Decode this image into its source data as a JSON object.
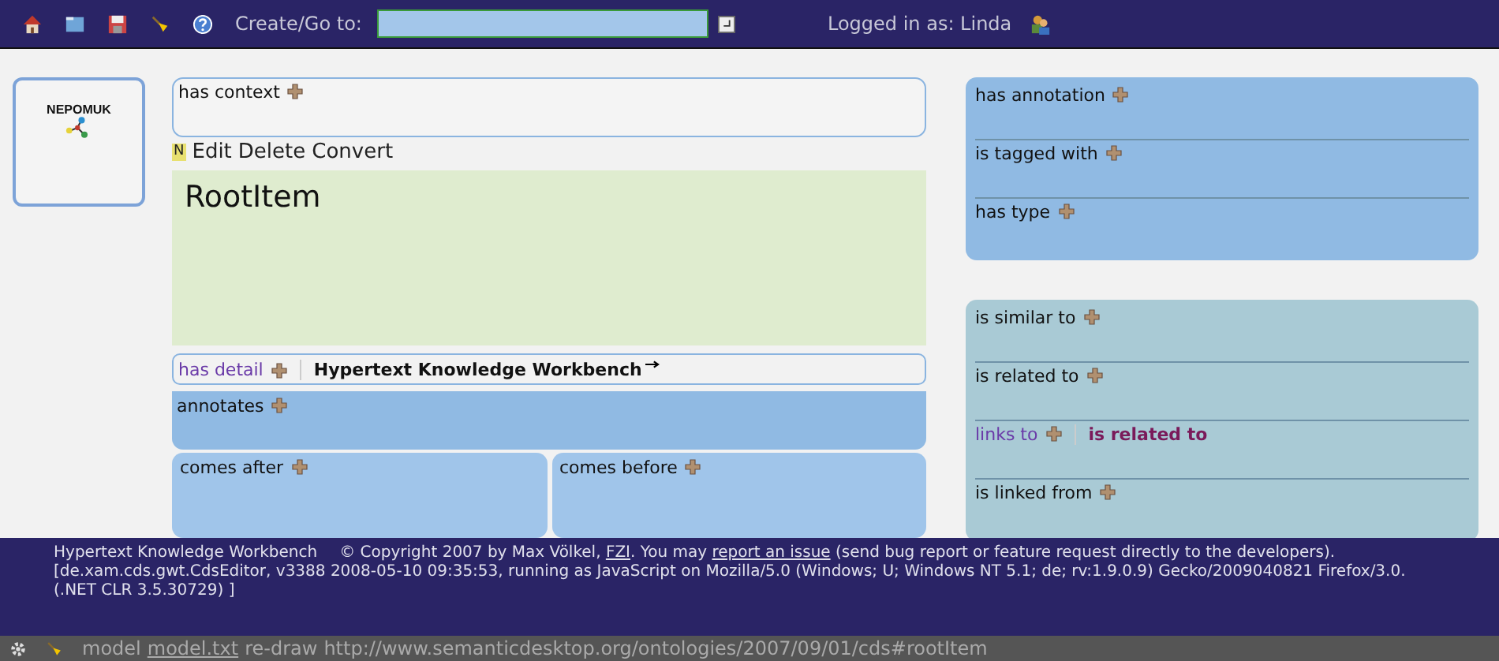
{
  "toolbar": {
    "create_label": "Create/Go to:",
    "login": "Logged in as: Linda"
  },
  "logo": {
    "text": "NEPOMUK"
  },
  "context": {
    "label": "has context"
  },
  "item": {
    "badge": "N",
    "actions": [
      "Edit",
      "Delete",
      "Convert"
    ],
    "title": "RootItem"
  },
  "detail": {
    "label": "has detail",
    "value": "Hypertext Knowledge Workbench"
  },
  "annotates": {
    "label": "annotates"
  },
  "sequence": [
    {
      "label": "comes after"
    },
    {
      "label": "comes before"
    }
  ],
  "right_panels": [
    {
      "color": "#90bae3",
      "rows": [
        {
          "label": "has annotation",
          "kind": "plain"
        },
        {
          "label": "is tagged with",
          "kind": "plain"
        },
        {
          "label": "has type",
          "kind": "plain"
        }
      ]
    },
    {
      "color": "#a9cad5",
      "rows": [
        {
          "label": "is similar to",
          "kind": "plain"
        },
        {
          "label": "is related to",
          "kind": "plain"
        },
        {
          "label": "links to",
          "kind": "linked",
          "value": "is related to"
        },
        {
          "label": "is linked from",
          "kind": "plain"
        }
      ]
    }
  ],
  "footer": {
    "app": "Hypertext Knowledge Workbench",
    "notice": [
      {
        "kind": "text",
        "text": "© Copyright 2007 by Max Völkel, "
      },
      {
        "kind": "link",
        "text": "FZI"
      },
      {
        "kind": "text",
        "text": ".  You may "
      },
      {
        "kind": "link",
        "text": "report an issue"
      },
      {
        "kind": "text",
        "text": " (send bug report or feature request directly to the developers)."
      }
    ],
    "build_lines": [
      "[de.xam.cds.gwt.CdsEditor, v3388 2008-05-10 09:35:53, running as JavaScript on Mozilla/5.0 (Windows; U; Windows NT 5.1; de; rv:1.9.0.9) Gecko/2009040821 Firefox/3.0.",
      "(.NET CLR 3.5.30729) ]"
    ]
  },
  "status_bar": [
    {
      "kind": "text",
      "text": "model"
    },
    {
      "kind": "link",
      "text": "model.txt"
    },
    {
      "kind": "text",
      "text": "re-draw"
    },
    {
      "kind": "text",
      "text": "http://www.semanticdesktop.org/ontologies/2007/09/01/cds#rootItem"
    }
  ]
}
